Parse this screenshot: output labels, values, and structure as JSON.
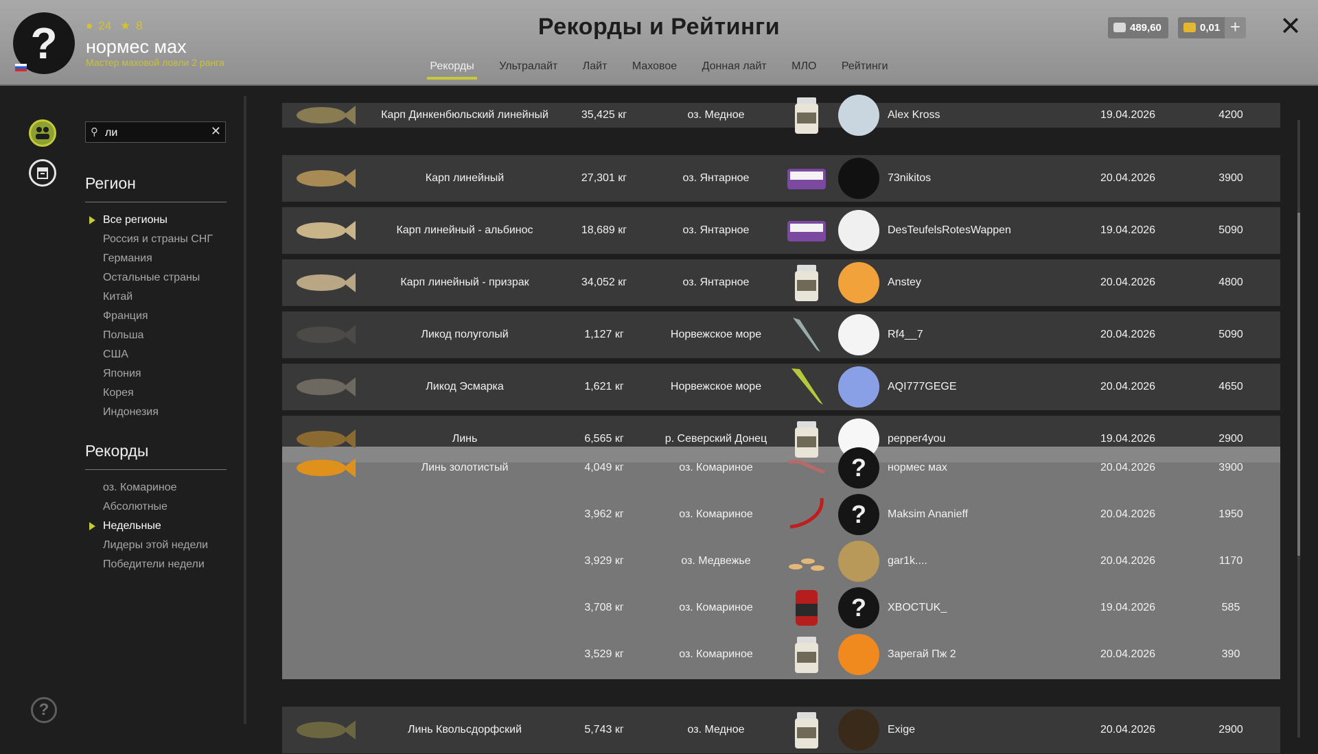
{
  "player": {
    "level": "24",
    "stars": "8",
    "name": "нормес мах",
    "rank": "Мастер маховой ловли 2 ранга",
    "avatar_glyph": "?"
  },
  "title": "Рекорды и Рейтинги",
  "tabs": [
    "Рекорды",
    "Ультралайт",
    "Лайт",
    "Маховое",
    "Донная лайт",
    "МЛО",
    "Рейтинги"
  ],
  "active_tab": "Рекорды",
  "currency": {
    "silver": "489,60",
    "gold": "0,01"
  },
  "search": {
    "value": "ли"
  },
  "region": {
    "title": "Регион",
    "items": [
      "Все регионы",
      "Россия и страны СНГ",
      "Германия",
      "Остальные страны",
      "Китай",
      "Франция",
      "Польша",
      "США",
      "Япония",
      "Корея",
      "Индонезия"
    ],
    "selected": "Все регионы"
  },
  "records": {
    "title": "Рекорды",
    "items": [
      "оз. Комариное",
      "Абсолютные",
      "Недельные",
      "Лидеры этой недели",
      "Победители недели"
    ],
    "selected": "Недельные"
  },
  "rows": [
    {
      "fish": "Карп Динкенбюльский линейный",
      "weight": "35,425 кг",
      "place": "оз. Медное",
      "player": "Alex Kross",
      "date": "19.04.2026",
      "score": "4200",
      "fish_color": "#8a7c52",
      "bait": "jar",
      "avatar": "photo"
    },
    {
      "fish": "Карп линейный",
      "weight": "27,301 кг",
      "place": "оз. Янтарное",
      "player": "73nikitos",
      "date": "20.04.2026",
      "score": "3900",
      "fish_color": "#a88a55",
      "bait": "box",
      "avatar": "dark"
    },
    {
      "fish": "Карп линейный - альбинос",
      "weight": "18,689 кг",
      "place": "оз. Янтарное",
      "player": "DesTeufelsRotesWappen",
      "date": "19.04.2026",
      "score": "5090",
      "fish_color": "#c9b48a",
      "bait": "box",
      "avatar": "crest"
    },
    {
      "fish": "Карп линейный - призрак",
      "weight": "34,052 кг",
      "place": "оз. Янтарное",
      "player": "Anstey",
      "date": "20.04.2026",
      "score": "4800",
      "fish_color": "#b8a684",
      "bait": "jar",
      "avatar": "sunset"
    },
    {
      "fish": "Ликод полуголый",
      "weight": "1,127 кг",
      "place": "Норвежское море",
      "player": "Rf4__7",
      "date": "20.04.2026",
      "score": "5090",
      "fish_color": "#4b4a47",
      "bait": "lure",
      "avatar": "woman"
    },
    {
      "fish": "Ликод Эсмарка",
      "weight": "1,621 кг",
      "place": "Норвежское море",
      "player": "AQI777GEGE",
      "date": "20.04.2026",
      "score": "4650",
      "fish_color": "#6d6860",
      "bait": "green",
      "avatar": "pixel"
    },
    {
      "fish": "Линь",
      "weight": "6,565 кг",
      "place": "р. Северский Донец",
      "player": "pepper4you",
      "date": "19.04.2026",
      "score": "2900",
      "fish_color": "#8a6a30",
      "bait": "jar",
      "avatar": "pepper"
    },
    {
      "fish": "Линь золотистый",
      "weight": "4,049 кг",
      "place": "оз. Комариное",
      "player": "нормес мах",
      "date": "20.04.2026",
      "score": "3900",
      "fish_color": "#e0911b",
      "bait": "worm",
      "avatar": "q"
    },
    {
      "fish": "",
      "weight": "3,962 кг",
      "place": "оз. Комариное",
      "player": "Maksim Ananieff",
      "date": "20.04.2026",
      "score": "1950",
      "bait": "redworm",
      "avatar": "q"
    },
    {
      "fish": "",
      "weight": "3,929 кг",
      "place": "оз. Медвежье",
      "player": "gar1k....",
      "date": "20.04.2026",
      "score": "1170",
      "bait": "grubs",
      "avatar": "dog"
    },
    {
      "fish": "",
      "weight": "3,708 кг",
      "place": "оз. Комариное",
      "player": "XBOCTUK_",
      "date": "19.04.2026",
      "score": "585",
      "bait": "redjar",
      "avatar": "q"
    },
    {
      "fish": "",
      "weight": "3,529 кг",
      "place": "оз. Комариное",
      "player": "Зарегай Пж 2",
      "date": "20.04.2026",
      "score": "390",
      "bait": "jar",
      "avatar": "orange"
    },
    {
      "fish": "Линь Квольсдорфский",
      "weight": "5,743 кг",
      "place": "оз. Медное",
      "player": "Exige",
      "date": "20.04.2026",
      "score": "2900",
      "fish_color": "#6b6540",
      "bait": "jar",
      "avatar": "face"
    }
  ]
}
